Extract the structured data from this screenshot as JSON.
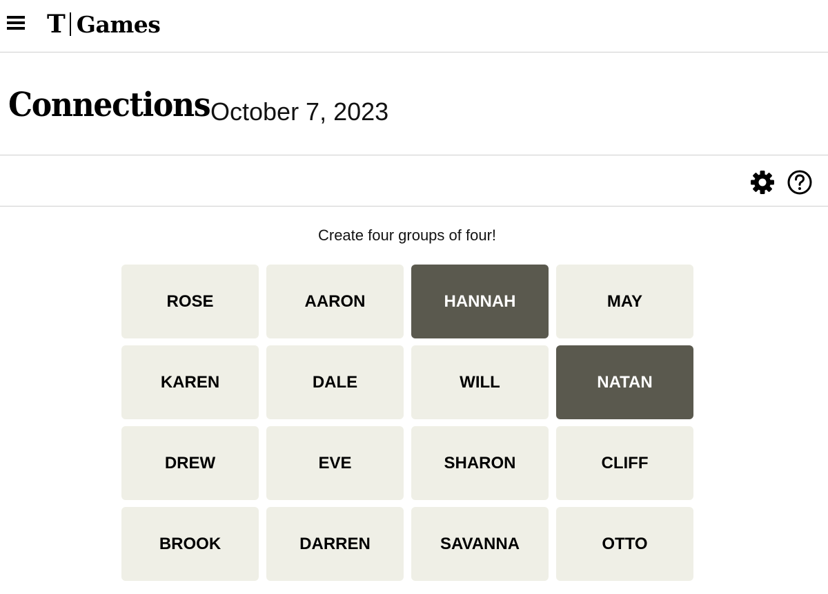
{
  "header": {
    "logo_mark": "T",
    "logo_text": "Games"
  },
  "game": {
    "title": "Connections",
    "date": "October 7, 2023",
    "instruction": "Create four groups of four!"
  },
  "icons": {
    "menu": "hamburger-menu-icon",
    "settings": "gear-icon",
    "help": "question-mark-icon"
  },
  "colors": {
    "tile": "#efefe6",
    "tile_selected": "#5a594e",
    "divider": "#cfcfcf"
  },
  "tiles": [
    {
      "word": "ROSE",
      "selected": false
    },
    {
      "word": "AARON",
      "selected": false
    },
    {
      "word": "HANNAH",
      "selected": true
    },
    {
      "word": "MAY",
      "selected": false
    },
    {
      "word": "KAREN",
      "selected": false
    },
    {
      "word": "DALE",
      "selected": false
    },
    {
      "word": "WILL",
      "selected": false
    },
    {
      "word": "NATAN",
      "selected": true
    },
    {
      "word": "DREW",
      "selected": false
    },
    {
      "word": "EVE",
      "selected": false
    },
    {
      "word": "SHARON",
      "selected": false
    },
    {
      "word": "CLIFF",
      "selected": false
    },
    {
      "word": "BROOK",
      "selected": false
    },
    {
      "word": "DARREN",
      "selected": false
    },
    {
      "word": "SAVANNA",
      "selected": false
    },
    {
      "word": "OTTO",
      "selected": false
    }
  ]
}
